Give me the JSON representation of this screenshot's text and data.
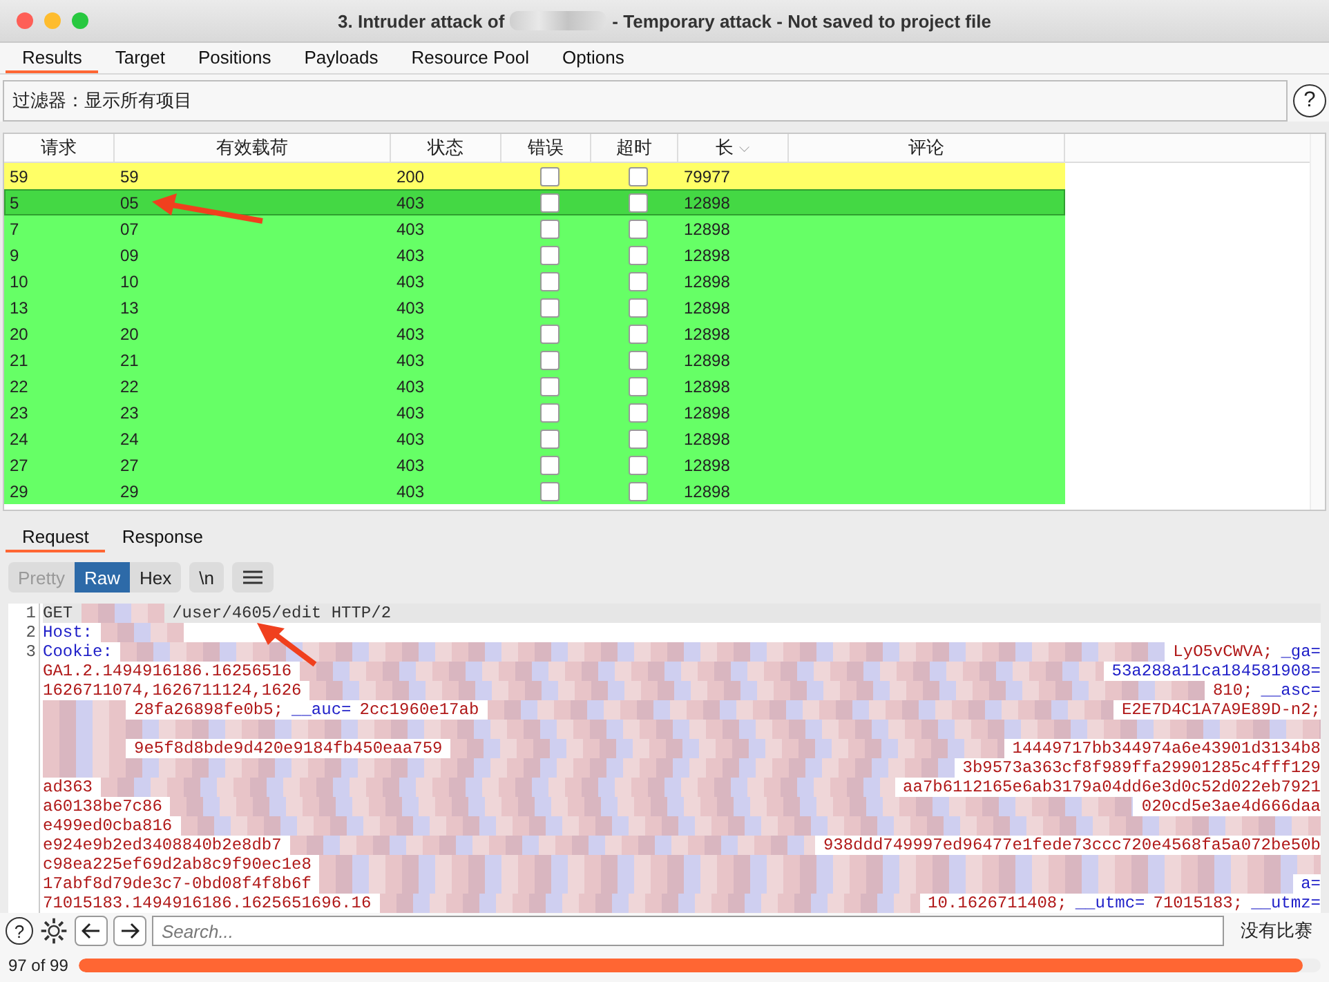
{
  "window": {
    "title_start": "3. Intruder attack of",
    "title_end": "- Temporary attack - Not saved to project file"
  },
  "tabs": [
    {
      "label": "Results",
      "selected": true
    },
    {
      "label": "Target",
      "selected": false
    },
    {
      "label": "Positions",
      "selected": false
    },
    {
      "label": "Payloads",
      "selected": false
    },
    {
      "label": "Resource Pool",
      "selected": false
    },
    {
      "label": "Options",
      "selected": false
    }
  ],
  "filter": {
    "label": "过滤器：显示所有项目",
    "help": "?"
  },
  "table": {
    "columns": [
      "请求",
      "有效载荷",
      "状态",
      "错误",
      "超时",
      "长",
      "评论"
    ],
    "sort_mark": "⌵",
    "rows": [
      {
        "request": "59",
        "payload": "59",
        "status": "200",
        "error": false,
        "timeout": false,
        "length": "79977",
        "color": "#ffff66",
        "selected": false
      },
      {
        "request": "5",
        "payload": "05",
        "status": "403",
        "error": false,
        "timeout": false,
        "length": "12898",
        "color": "#44d844",
        "selected": true
      },
      {
        "request": "7",
        "payload": "07",
        "status": "403",
        "error": false,
        "timeout": false,
        "length": "12898",
        "color": "#66ff66",
        "selected": false
      },
      {
        "request": "9",
        "payload": "09",
        "status": "403",
        "error": false,
        "timeout": false,
        "length": "12898",
        "color": "#66ff66",
        "selected": false
      },
      {
        "request": "10",
        "payload": "10",
        "status": "403",
        "error": false,
        "timeout": false,
        "length": "12898",
        "color": "#66ff66",
        "selected": false
      },
      {
        "request": "13",
        "payload": "13",
        "status": "403",
        "error": false,
        "timeout": false,
        "length": "12898",
        "color": "#66ff66",
        "selected": false
      },
      {
        "request": "20",
        "payload": "20",
        "status": "403",
        "error": false,
        "timeout": false,
        "length": "12898",
        "color": "#66ff66",
        "selected": false
      },
      {
        "request": "21",
        "payload": "21",
        "status": "403",
        "error": false,
        "timeout": false,
        "length": "12898",
        "color": "#66ff66",
        "selected": false
      },
      {
        "request": "22",
        "payload": "22",
        "status": "403",
        "error": false,
        "timeout": false,
        "length": "12898",
        "color": "#66ff66",
        "selected": false
      },
      {
        "request": "23",
        "payload": "23",
        "status": "403",
        "error": false,
        "timeout": false,
        "length": "12898",
        "color": "#66ff66",
        "selected": false
      },
      {
        "request": "24",
        "payload": "24",
        "status": "403",
        "error": false,
        "timeout": false,
        "length": "12898",
        "color": "#66ff66",
        "selected": false
      },
      {
        "request": "27",
        "payload": "27",
        "status": "403",
        "error": false,
        "timeout": false,
        "length": "12898",
        "color": "#66ff66",
        "selected": false
      },
      {
        "request": "29",
        "payload": "29",
        "status": "403",
        "error": false,
        "timeout": false,
        "length": "12898",
        "color": "#66ff66",
        "selected": false
      }
    ]
  },
  "message_tabs": [
    {
      "label": "Request",
      "selected": true
    },
    {
      "label": "Response",
      "selected": false
    }
  ],
  "view_buttons": [
    {
      "label": "Pretty",
      "selected": false
    },
    {
      "label": "Raw",
      "selected": true
    },
    {
      "label": "Hex",
      "selected": false
    },
    {
      "label": "\\n",
      "selected": false
    }
  ],
  "editor": {
    "lines": [
      {
        "number": "1",
        "segments": [
          {
            "kind": "plain",
            "text": "GET"
          },
          {
            "kind": "blur"
          },
          {
            "kind": "plain",
            "text": "/user/4605/edit HTTP/2"
          }
        ]
      },
      {
        "number": "2",
        "segments": [
          {
            "kind": "key",
            "text": "Host:"
          },
          {
            "kind": "blur"
          }
        ]
      },
      {
        "number": "3",
        "segments": [
          {
            "kind": "key",
            "text": "Cookie:"
          },
          {
            "kind": "blur_wide"
          },
          {
            "kind": "value",
            "text": "LyO5vCWVA;"
          },
          {
            "kind": "key",
            "text": "_ga="
          }
        ]
      },
      {
        "segments": [
          {
            "kind": "value",
            "text": "GA1.2.1494916186.16256516"
          },
          {
            "kind": "blur_wide"
          },
          {
            "kind": "key",
            "text": "53a288a11ca184581908="
          }
        ]
      },
      {
        "segments": [
          {
            "kind": "value",
            "text": "1626711074,1626711124,1626"
          },
          {
            "kind": "blur_wide"
          },
          {
            "kind": "value",
            "text": "810;"
          },
          {
            "kind": "key",
            "text": "__asc="
          }
        ]
      },
      {
        "segments": [
          {
            "kind": "blur"
          },
          {
            "kind": "value",
            "text": "28fa26898fe0b5;"
          },
          {
            "kind": "key",
            "text": "__auc="
          },
          {
            "kind": "value",
            "text": "2cc1960e17ab"
          },
          {
            "kind": "blur_wide"
          },
          {
            "kind": "value",
            "text": "E2E7D4C1A7A9E89D-n2;"
          }
        ]
      },
      {
        "segments": [
          {
            "kind": "blur_wide"
          }
        ]
      },
      {
        "segments": [
          {
            "kind": "blur"
          },
          {
            "kind": "value",
            "text": "9e5f8d8bde9d420e9184fb450eaa759"
          },
          {
            "kind": "blur_wide"
          },
          {
            "kind": "value",
            "text": "14449717bb344974a6e43901d3134b8"
          }
        ]
      },
      {
        "segments": [
          {
            "kind": "blur_wide"
          },
          {
            "kind": "value",
            "text": "3b9573a363cf8f989ffa29901285c4fff129"
          }
        ]
      },
      {
        "segments": [
          {
            "kind": "value",
            "text": "ad363"
          },
          {
            "kind": "blur_wide"
          },
          {
            "kind": "value",
            "text": "aa7b6112165e6ab3179a04dd6e3d0c52d022eb7921"
          }
        ]
      },
      {
        "segments": [
          {
            "kind": "value",
            "text": "a60138be7c86"
          },
          {
            "kind": "blur_wide"
          },
          {
            "kind": "value",
            "text": "020cd5e3ae4d666daa"
          }
        ]
      },
      {
        "segments": [
          {
            "kind": "value",
            "text": "e499ed0cba816"
          },
          {
            "kind": "blur_wide"
          }
        ]
      },
      {
        "segments": [
          {
            "kind": "value",
            "text": "e924e9b2ed3408840b2e8db7"
          },
          {
            "kind": "blur_wide"
          },
          {
            "kind": "value",
            "text": "938ddd749997ed96477e1fede73ccc720e4568fa5a072be50b"
          }
        ]
      },
      {
        "segments": [
          {
            "kind": "value",
            "text": "c98ea225ef69d2ab8c9f90ec1e8"
          },
          {
            "kind": "blur_wide"
          }
        ]
      },
      {
        "segments": [
          {
            "kind": "value",
            "text": "17abf8d79de3c7-0bd08f4f8b6f"
          },
          {
            "kind": "blur_wide"
          },
          {
            "kind": "key",
            "text": "a="
          }
        ]
      },
      {
        "segments": [
          {
            "kind": "value",
            "text": "71015183.1494916186.1625651696.16"
          },
          {
            "kind": "blur_wide"
          },
          {
            "kind": "value",
            "text": "10.1626711408;"
          },
          {
            "kind": "key",
            "text": "__utmc="
          },
          {
            "kind": "value",
            "text": "71015183;"
          },
          {
            "kind": "key",
            "text": "__utmz="
          }
        ]
      }
    ]
  },
  "search": {
    "placeholder": "Search...",
    "result": "没有比赛"
  },
  "status": {
    "count": "97 of 99",
    "level": 0.985
  }
}
